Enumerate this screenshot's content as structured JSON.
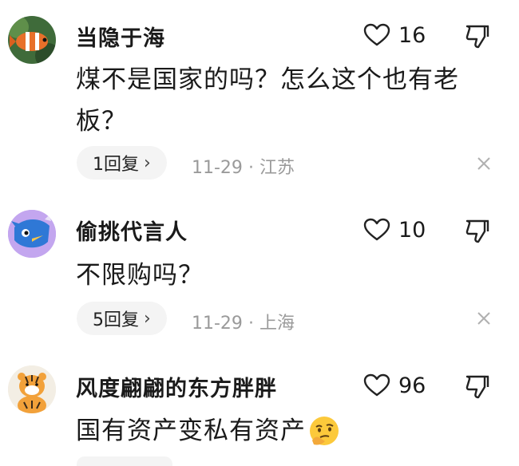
{
  "comments": [
    {
      "username": "当隐于海",
      "likes": "16",
      "text": "煤不是国家的吗？怎么这个也有老板？",
      "reply_label": "1回复",
      "date": "11-29",
      "location": "江苏",
      "avatar_icon": "clownfish-avatar-icon"
    },
    {
      "username": "偷挑代言人",
      "likes": "10",
      "text": "不限购吗？",
      "reply_label": "5回复",
      "date": "11-29",
      "location": "上海",
      "avatar_icon": "blue-fish-avatar-icon"
    },
    {
      "username": "风度翩翩的东方胖胖",
      "likes": "96",
      "text": "国有资产变私有资产",
      "emoji_icon": "thinking-face-emoji-icon",
      "avatar_icon": "tiger-avatar-icon"
    }
  ],
  "meta_separator": "·",
  "colors": {
    "text": "#1a1a1a",
    "meta": "#9a9a9a",
    "reply_bg": "#f4f4f4",
    "avatar2_bg": "#c3a6ef",
    "fish_blue": "#2f78d6"
  }
}
